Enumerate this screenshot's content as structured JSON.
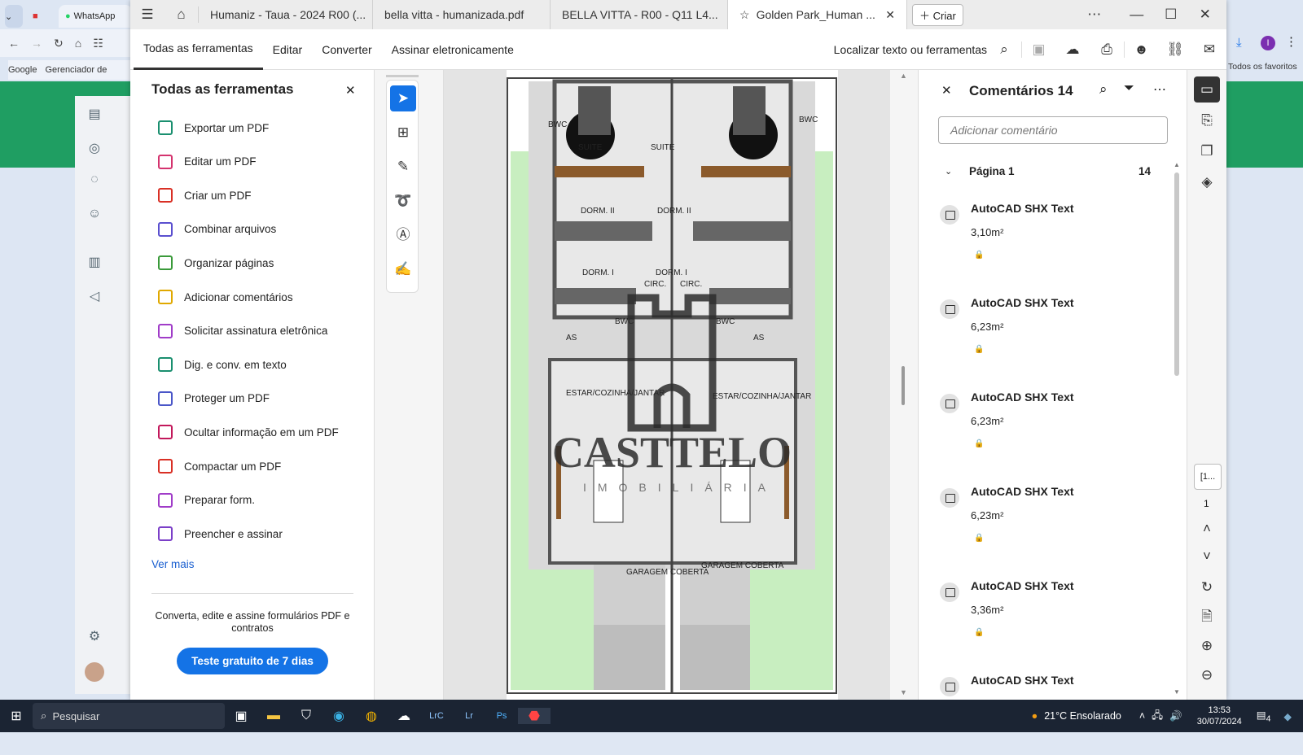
{
  "browser": {
    "tab_whatsapp": "WhatsApp",
    "bookmarks": [
      "Google",
      "Gerenciador de"
    ],
    "right_bookmark": "Todos os favoritos",
    "avatar_letter": "I"
  },
  "acrobat": {
    "tabs": [
      "Humaniz - Taua - 2024 R00 (...",
      "bella vitta - humanizada.pdf",
      "BELLA VITTA - R00 - Q11 L4...",
      "Golden Park_Human ..."
    ],
    "create_label": "Criar",
    "menus": [
      "Todas as ferramentas",
      "Editar",
      "Converter",
      "Assinar eletronicamente"
    ],
    "search_label": "Localizar texto ou ferramentas"
  },
  "tools_panel": {
    "title": "Todas as ferramentas",
    "items": [
      {
        "label": "Exportar um PDF",
        "color": "#1a8f6f"
      },
      {
        "label": "Editar um PDF",
        "color": "#d4336e"
      },
      {
        "label": "Criar um PDF",
        "color": "#d93025"
      },
      {
        "label": "Combinar arquivos",
        "color": "#5a4fcf"
      },
      {
        "label": "Organizar páginas",
        "color": "#3a9a3a"
      },
      {
        "label": "Adicionar comentários",
        "color": "#e0a800"
      },
      {
        "label": "Solicitar assinatura eletrônica",
        "color": "#a03cc8"
      },
      {
        "label": "Dig. e conv. em texto",
        "color": "#1a8f6f"
      },
      {
        "label": "Proteger um PDF",
        "color": "#4a56c8"
      },
      {
        "label": "Ocultar informação em um PDF",
        "color": "#c2185b"
      },
      {
        "label": "Compactar um PDF",
        "color": "#d93025"
      },
      {
        "label": "Preparar form.",
        "color": "#a03cc8"
      },
      {
        "label": "Preencher e assinar",
        "color": "#7b3fc8"
      }
    ],
    "see_more": "Ver mais",
    "promo_text": "Converta, edite e assine formulários PDF e contratos",
    "trial_button": "Teste gratuito de 7 dias"
  },
  "plan": {
    "labels": [
      "SUITE",
      "SUITE",
      "DORM. II",
      "DORM. II",
      "DORM. I",
      "DORM. I",
      "CIRC.",
      "CIRC.",
      "BWC",
      "BWC",
      "BWC",
      "BWC",
      "AS",
      "AS",
      "ESTAR/COZINHA/JANTAR",
      "ESTAR/COZINHA/JANTAR",
      "GARAGEM COBERTA",
      "GARAGEM COBERTA"
    ],
    "watermark": "CASTTELO",
    "watermark_sub": "IMOBILIÁRIA"
  },
  "comments": {
    "title": "Comentários 14",
    "add_placeholder": "Adicionar comentário",
    "page_label": "Página 1",
    "page_count": "14",
    "items": [
      {
        "author": "AutoCAD SHX Text",
        "text": "3,10m²"
      },
      {
        "author": "AutoCAD SHX Text",
        "text": "6,23m²"
      },
      {
        "author": "AutoCAD SHX Text",
        "text": "6,23m²"
      },
      {
        "author": "AutoCAD SHX Text",
        "text": "6,23m²"
      },
      {
        "author": "AutoCAD SHX Text",
        "text": "3,36m²"
      },
      {
        "author": "AutoCAD SHX Text",
        "text": ""
      }
    ]
  },
  "rail": {
    "page_box": "[1...",
    "page_num": "1"
  },
  "taskbar": {
    "search": "Pesquisar",
    "weather": "21°C  Ensolarado",
    "time": "13:53",
    "date": "30/07/2024",
    "notif": "4"
  }
}
